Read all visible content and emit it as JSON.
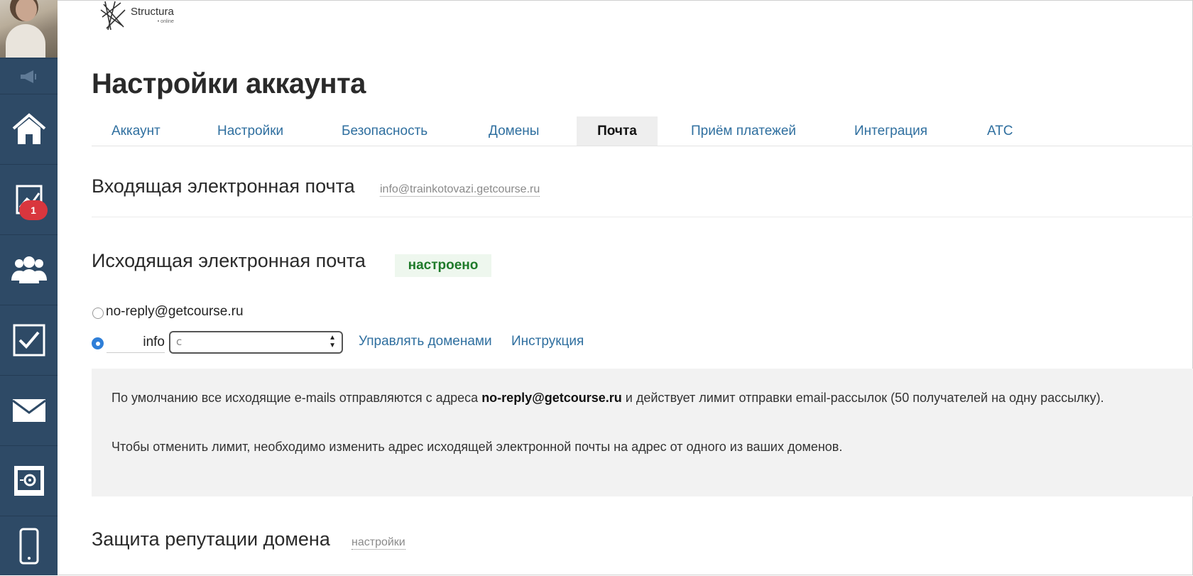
{
  "logo": {
    "name": "Structura",
    "sub": "• online"
  },
  "sidebar": {
    "badge_count": "1",
    "items": [
      "megaphone-icon",
      "home-icon",
      "chart-icon",
      "users-icon",
      "tasks-icon",
      "mail-icon",
      "safe-icon",
      "mobile-icon"
    ]
  },
  "page_title": "Настройки аккаунта",
  "tabs": [
    "Аккаунт",
    "Настройки",
    "Безопасность",
    "Домены",
    "Почта",
    "Приём платежей",
    "Интеграция",
    "АТС"
  ],
  "active_tab": "Почта",
  "incoming": {
    "title": "Входящая электронная почта",
    "address": "info@trainkotovazi.getcourse.ru"
  },
  "outgoing": {
    "title": "Исходящая электронная почта",
    "status": "настроено",
    "option_default": "no-reply@getcourse.ru",
    "prefix_value": "info",
    "manage_domains_link": "Управлять доменами",
    "instruction_link": "Инструкция"
  },
  "info": {
    "p1_before": "По умолчанию все исходящие e-mails отправляются с адреса ",
    "p1_bold": "no-reply@getcourse.ru",
    "p1_after": " и действует лимит отправки email-рассылок (50 получателей на одну рассылку).",
    "p2": "Чтобы отменить лимит, необходимо изменить адрес исходящей электронной почты на адрес от одного из ваших доменов."
  },
  "reputation": {
    "title": "Защита репутации домена",
    "settings_link": "настройки"
  },
  "colors": {
    "sidebar": "#2e4a66",
    "link": "#2f6f9f",
    "badge": "#d9363e",
    "status_green": "#1f7a2a"
  }
}
